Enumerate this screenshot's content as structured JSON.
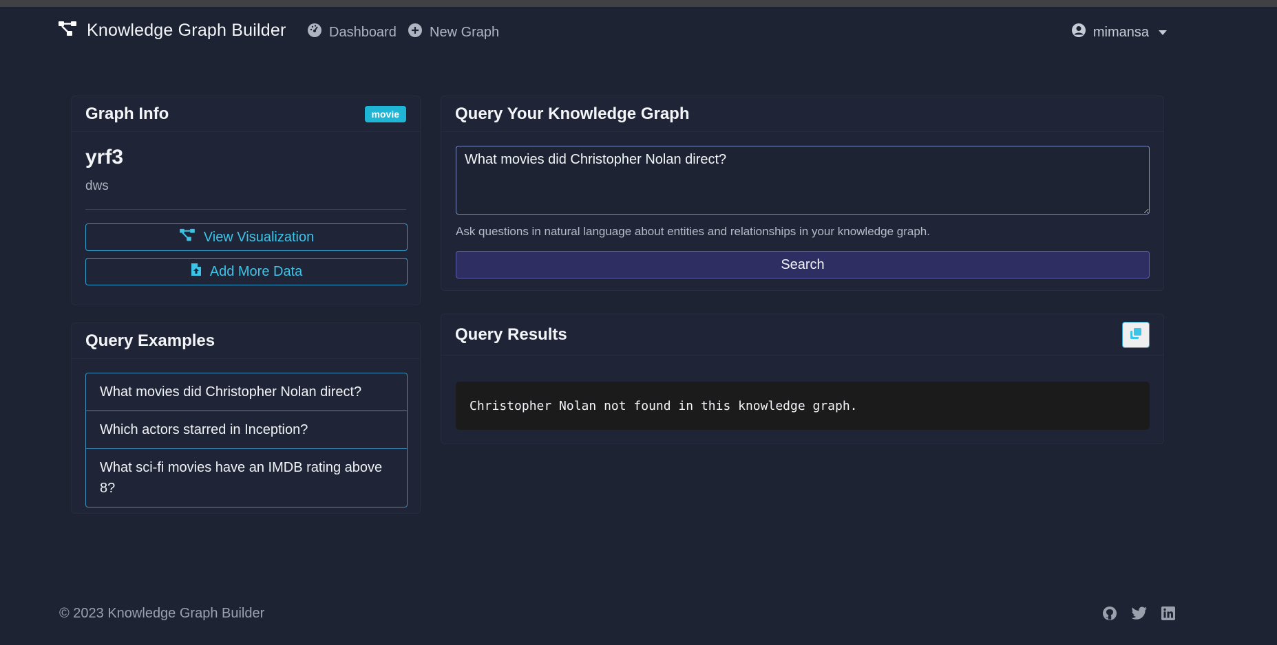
{
  "navbar": {
    "brand": "Knowledge Graph Builder",
    "links": [
      {
        "label": "Dashboard",
        "icon": "dashboard-icon"
      },
      {
        "label": "New Graph",
        "icon": "plus-circle-icon"
      }
    ],
    "user": "mimansa"
  },
  "graph_info": {
    "title": "Graph Info",
    "badge": "movie",
    "name": "yrf3",
    "description": "dws",
    "view_button": "View Visualization",
    "add_button": "Add More Data"
  },
  "examples": {
    "title": "Query Examples",
    "items": [
      "What movies did Christopher Nolan direct?",
      "Which actors starred in Inception?",
      "What sci-fi movies have an IMDB rating above 8?"
    ]
  },
  "query": {
    "title": "Query Your Knowledge Graph",
    "value": "What movies did Christopher Nolan direct?",
    "hint": "Ask questions in natural language about entities and relationships in your knowledge graph.",
    "button": "Search"
  },
  "results": {
    "title": "Query Results",
    "text": "Christopher Nolan not found in this knowledge graph."
  },
  "footer": {
    "copyright": "© 2023 Knowledge Graph Builder",
    "icons": [
      "github-icon",
      "twitter-icon",
      "linkedin-icon"
    ]
  },
  "colors": {
    "background": "#1d2333",
    "accent": "#3cc4e8",
    "badge": "#1fb6d6",
    "search_button": "#2e2e62"
  }
}
